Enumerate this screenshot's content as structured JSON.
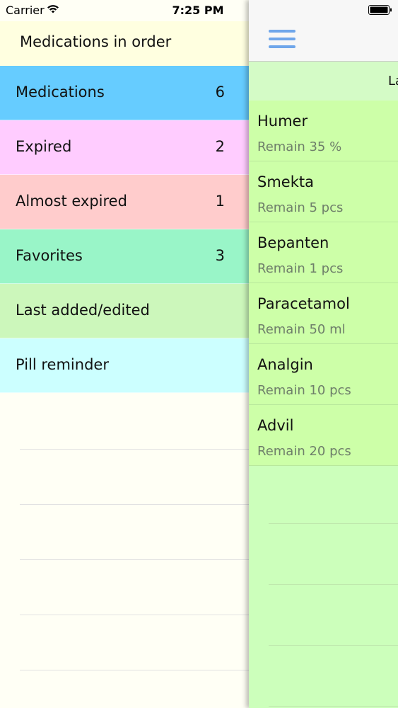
{
  "status_bar": {
    "carrier": "Carrier",
    "time": "7:25 PM",
    "icons": [
      "wifi-icon",
      "battery-icon"
    ]
  },
  "sidebar": {
    "title": "Medications in order",
    "items": [
      {
        "label": "Medications",
        "count": "6",
        "color": "#66ccff"
      },
      {
        "label": "Expired",
        "count": "2",
        "color": "#ffccff"
      },
      {
        "label": "Almost expired",
        "count": "1",
        "color": "#ffcccc"
      },
      {
        "label": "Favorites",
        "count": "3",
        "color": "#99f5c8"
      },
      {
        "label": "Last added/edited",
        "count": "",
        "color": "#ccf7bb"
      },
      {
        "label": "Pill reminder",
        "count": "",
        "color": "#ccffff"
      }
    ]
  },
  "main": {
    "menu_icon": "hamburger-menu-icon",
    "subheader": "La",
    "medications": [
      {
        "name": "Humer",
        "remain": "Remain 35 %"
      },
      {
        "name": "Smekta",
        "remain": "Remain 5 pcs"
      },
      {
        "name": "Bepanten",
        "remain": "Remain 1 pcs"
      },
      {
        "name": "Paracetamol",
        "remain": "Remain 50 ml"
      },
      {
        "name": "Analgin",
        "remain": "Remain 10 pcs"
      },
      {
        "name": "Advil",
        "remain": "Remain 20 pcs"
      }
    ]
  },
  "colors": {
    "accent": "#6fa6ea",
    "main_background": "#ccffbb",
    "sidebar_header": "#ffffe0"
  }
}
